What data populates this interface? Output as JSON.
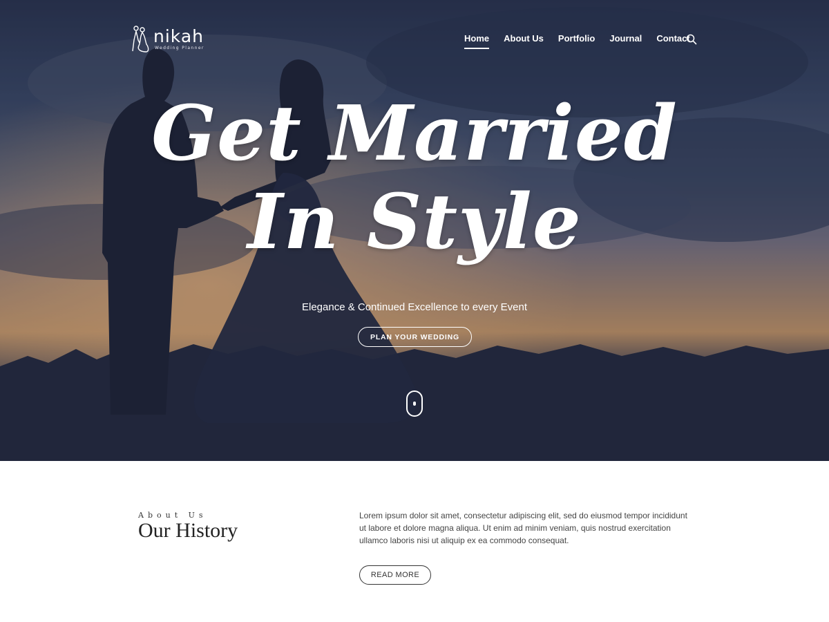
{
  "brand": {
    "name": "nikah",
    "tagline": "Wedding Planner"
  },
  "nav": {
    "items": [
      {
        "label": "Home",
        "active": true
      },
      {
        "label": "About Us",
        "active": false
      },
      {
        "label": "Portfolio",
        "active": false
      },
      {
        "label": "Journal",
        "active": false
      },
      {
        "label": "Contact",
        "active": false
      }
    ],
    "search_icon": "search-icon"
  },
  "hero": {
    "headline_line1": "Get Married",
    "headline_line2": "In Style",
    "subheading": "Elegance & Continued Excellence to every Event",
    "cta_label": "PLAN YOUR WEDDING",
    "scroll_icon": "mouse-scroll-icon",
    "background_image": "couple-silhouette-sunset-photo"
  },
  "about": {
    "eyebrow": "About Us",
    "title": "Our History",
    "body": "Lorem ipsum dolor sit amet, consectetur adipiscing elit, sed do eiusmod tempor incididunt ut labore et dolore magna aliqua. Ut enim ad minim veniam, quis nostrud exercitation ullamco laboris nisi ut aliquip ex ea commodo consequat.",
    "button_label": "READ MORE"
  },
  "colors": {
    "hero_dark": "#282d42",
    "sky_blue": "#3a4867",
    "sunset": "#c99a6b",
    "text_dark": "#222222",
    "white": "#ffffff"
  }
}
